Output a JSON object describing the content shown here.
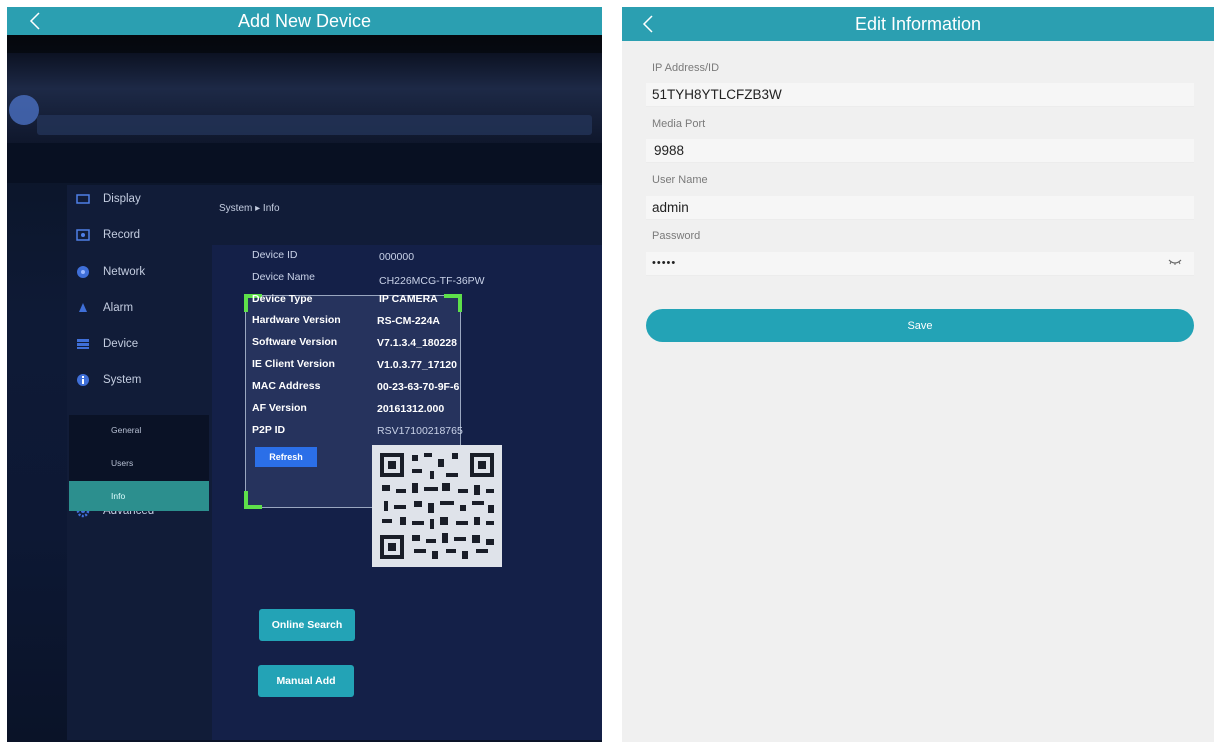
{
  "left": {
    "header_title": "Add New Device",
    "sidebar": [
      {
        "label": "Display",
        "icon": "monitor-icon"
      },
      {
        "label": "Record",
        "icon": "record-icon"
      },
      {
        "label": "Network",
        "icon": "network-icon"
      },
      {
        "label": "Alarm",
        "icon": "alarm-icon"
      },
      {
        "label": "Device",
        "icon": "device-icon"
      },
      {
        "label": "System",
        "icon": "info-icon"
      },
      {
        "label": "Advanced",
        "icon": "gear-icon"
      }
    ],
    "sub_items": [
      "General",
      "Users",
      "Info"
    ],
    "breadcrumb": "System  ▸  Info",
    "info": [
      {
        "label": "Device ID",
        "value": "000000"
      },
      {
        "label": "Device Name",
        "value": "CH226MCG-TF-36PW"
      },
      {
        "label": "Device Type",
        "value": "IP CAMERA"
      },
      {
        "label": "Hardware Version",
        "value": "RS-CM-224A"
      },
      {
        "label": "Software Version",
        "value": "V7.1.3.4_180228"
      },
      {
        "label": "IE Client Version",
        "value": "V1.0.3.77_17120"
      },
      {
        "label": "MAC Address",
        "value": "00-23-63-70-9F-6"
      },
      {
        "label": "AF Version",
        "value": "20161312.000"
      },
      {
        "label": "P2P ID",
        "value": "RSV17100218765"
      }
    ],
    "refresh_label": "Refresh",
    "online_search_label": "Online Search",
    "manual_add_label": "Manual Add"
  },
  "right": {
    "header_title": "Edit Information",
    "fields": [
      {
        "label": "IP Address/ID",
        "value": "51TYH8YTLCFZB3W"
      },
      {
        "label": "Media Port",
        "value": "9988"
      },
      {
        "label": "User Name",
        "value": "admin"
      },
      {
        "label": "Password",
        "value": "•••••"
      }
    ],
    "save_label": "Save"
  },
  "colors": {
    "accent": "#2b9fb1",
    "button": "#23a3b6",
    "scan_corner": "#5ee04a"
  }
}
